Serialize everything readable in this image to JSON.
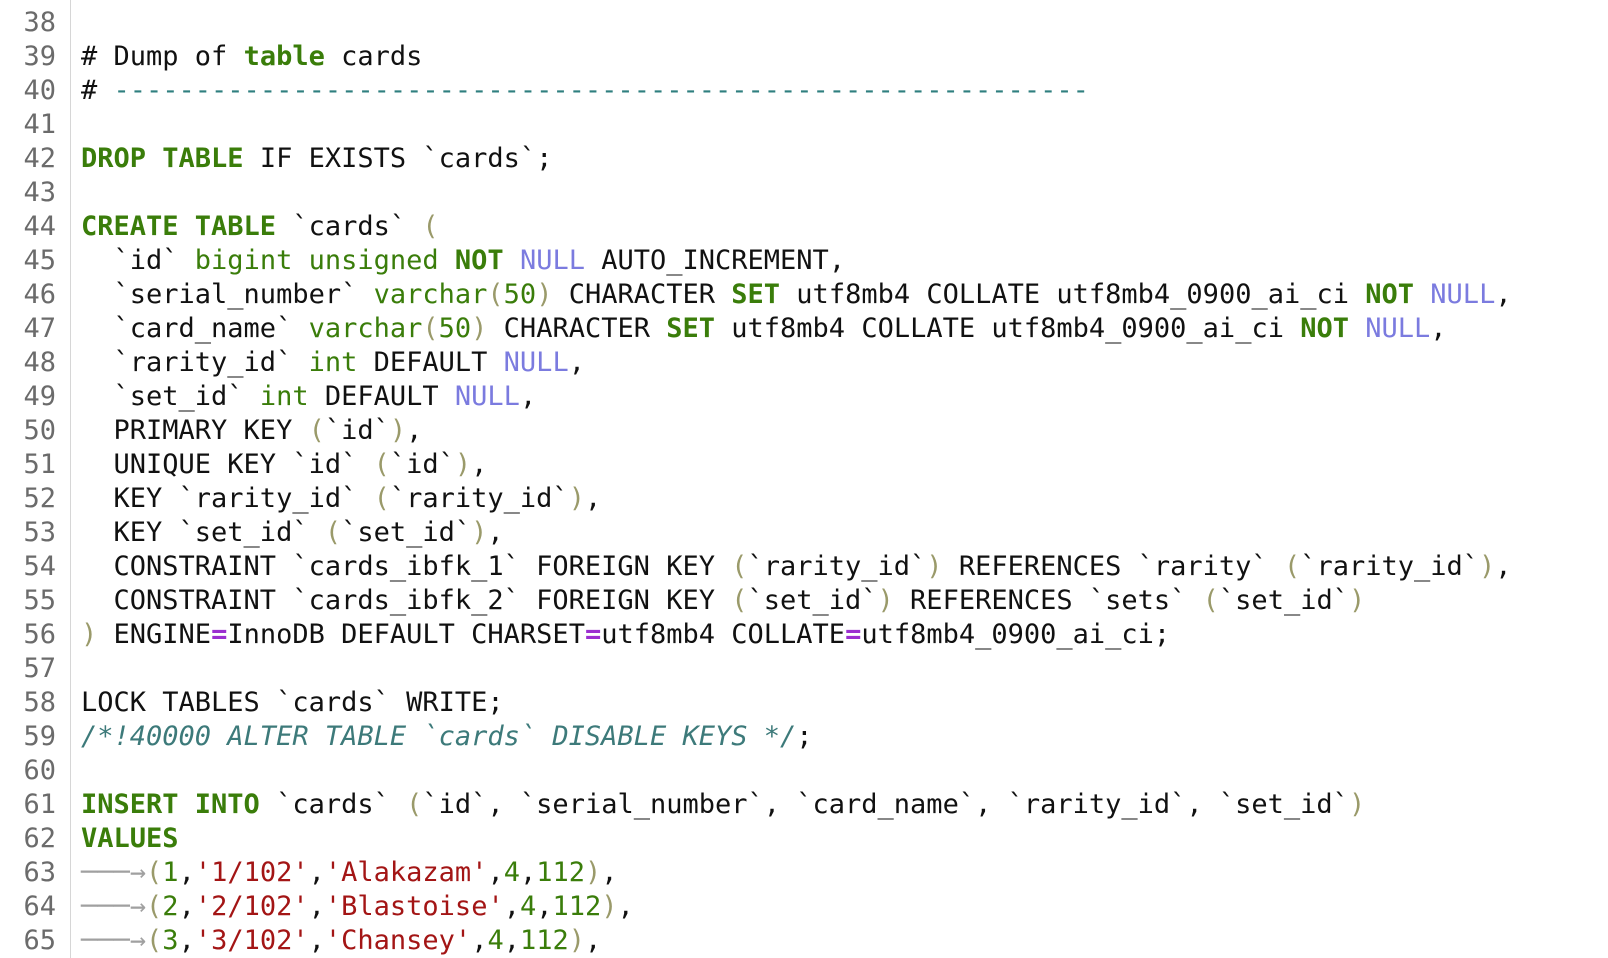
{
  "editor": {
    "language": "SQL",
    "colors": {
      "keyword": "#3a7d0a",
      "null_literal": "#7b7bdf",
      "string": "#a31515",
      "number": "#3a7d0a",
      "comment": "#3d7a7a",
      "operator": "#9b2fd0",
      "line_number": "#6b6b6b"
    },
    "lines": [
      {
        "n": "38",
        "t": [
          {
            "s": "",
            "c": "plain"
          }
        ]
      },
      {
        "n": "39",
        "t": [
          {
            "s": "# Dump of ",
            "c": "plain"
          },
          {
            "s": "table",
            "c": "kw"
          },
          {
            "s": " cards",
            "c": "plain"
          }
        ]
      },
      {
        "n": "40",
        "t": [
          {
            "s": "# ",
            "c": "plain"
          },
          {
            "s": "------------------------------------------------------------",
            "c": "dash"
          }
        ]
      },
      {
        "n": "41",
        "t": [
          {
            "s": "",
            "c": "plain"
          }
        ]
      },
      {
        "n": "42",
        "t": [
          {
            "s": "DROP TABLE",
            "c": "kw"
          },
          {
            "s": " IF EXISTS `cards`;",
            "c": "plain"
          }
        ]
      },
      {
        "n": "43",
        "t": [
          {
            "s": "",
            "c": "plain"
          }
        ]
      },
      {
        "n": "44",
        "t": [
          {
            "s": "CREATE TABLE",
            "c": "kw"
          },
          {
            "s": " `cards` ",
            "c": "plain"
          },
          {
            "s": "(",
            "c": "par"
          }
        ]
      },
      {
        "n": "45",
        "t": [
          {
            "s": "  `id` ",
            "c": "plain"
          },
          {
            "s": "bigint unsigned",
            "c": "ty"
          },
          {
            "s": " ",
            "c": "plain"
          },
          {
            "s": "NOT",
            "c": "kw"
          },
          {
            "s": " ",
            "c": "plain"
          },
          {
            "s": "NULL",
            "c": "nul"
          },
          {
            "s": " AUTO_INCREMENT,",
            "c": "plain"
          }
        ]
      },
      {
        "n": "46",
        "t": [
          {
            "s": "  `serial_number` ",
            "c": "plain"
          },
          {
            "s": "varchar",
            "c": "ty"
          },
          {
            "s": "(",
            "c": "par"
          },
          {
            "s": "50",
            "c": "num"
          },
          {
            "s": ")",
            "c": "par"
          },
          {
            "s": " CHARACTER ",
            "c": "plain"
          },
          {
            "s": "SET",
            "c": "kw"
          },
          {
            "s": " utf8mb4 COLLATE utf8mb4_0900_ai_ci ",
            "c": "plain"
          },
          {
            "s": "NOT",
            "c": "kw"
          },
          {
            "s": " ",
            "c": "plain"
          },
          {
            "s": "NULL",
            "c": "nul"
          },
          {
            "s": ",",
            "c": "plain"
          }
        ]
      },
      {
        "n": "47",
        "t": [
          {
            "s": "  `card_name` ",
            "c": "plain"
          },
          {
            "s": "varchar",
            "c": "ty"
          },
          {
            "s": "(",
            "c": "par"
          },
          {
            "s": "50",
            "c": "num"
          },
          {
            "s": ")",
            "c": "par"
          },
          {
            "s": " CHARACTER ",
            "c": "plain"
          },
          {
            "s": "SET",
            "c": "kw"
          },
          {
            "s": " utf8mb4 COLLATE utf8mb4_0900_ai_ci ",
            "c": "plain"
          },
          {
            "s": "NOT",
            "c": "kw"
          },
          {
            "s": " ",
            "c": "plain"
          },
          {
            "s": "NULL",
            "c": "nul"
          },
          {
            "s": ",",
            "c": "plain"
          }
        ]
      },
      {
        "n": "48",
        "t": [
          {
            "s": "  `rarity_id` ",
            "c": "plain"
          },
          {
            "s": "int",
            "c": "ty"
          },
          {
            "s": " DEFAULT ",
            "c": "plain"
          },
          {
            "s": "NULL",
            "c": "nul"
          },
          {
            "s": ",",
            "c": "plain"
          }
        ]
      },
      {
        "n": "49",
        "t": [
          {
            "s": "  `set_id` ",
            "c": "plain"
          },
          {
            "s": "int",
            "c": "ty"
          },
          {
            "s": " DEFAULT ",
            "c": "plain"
          },
          {
            "s": "NULL",
            "c": "nul"
          },
          {
            "s": ",",
            "c": "plain"
          }
        ]
      },
      {
        "n": "50",
        "t": [
          {
            "s": "  PRIMARY KEY ",
            "c": "plain"
          },
          {
            "s": "(",
            "c": "par"
          },
          {
            "s": "`id`",
            "c": "plain"
          },
          {
            "s": ")",
            "c": "par"
          },
          {
            "s": ",",
            "c": "plain"
          }
        ]
      },
      {
        "n": "51",
        "t": [
          {
            "s": "  UNIQUE KEY `id` ",
            "c": "plain"
          },
          {
            "s": "(",
            "c": "par"
          },
          {
            "s": "`id`",
            "c": "plain"
          },
          {
            "s": ")",
            "c": "par"
          },
          {
            "s": ",",
            "c": "plain"
          }
        ]
      },
      {
        "n": "52",
        "t": [
          {
            "s": "  KEY `rarity_id` ",
            "c": "plain"
          },
          {
            "s": "(",
            "c": "par"
          },
          {
            "s": "`rarity_id`",
            "c": "plain"
          },
          {
            "s": ")",
            "c": "par"
          },
          {
            "s": ",",
            "c": "plain"
          }
        ]
      },
      {
        "n": "53",
        "t": [
          {
            "s": "  KEY `set_id` ",
            "c": "plain"
          },
          {
            "s": "(",
            "c": "par"
          },
          {
            "s": "`set_id`",
            "c": "plain"
          },
          {
            "s": ")",
            "c": "par"
          },
          {
            "s": ",",
            "c": "plain"
          }
        ]
      },
      {
        "n": "54",
        "t": [
          {
            "s": "  CONSTRAINT `cards_ibfk_1` FOREIGN KEY ",
            "c": "plain"
          },
          {
            "s": "(",
            "c": "par"
          },
          {
            "s": "`rarity_id`",
            "c": "plain"
          },
          {
            "s": ")",
            "c": "par"
          },
          {
            "s": " REFERENCES `rarity` ",
            "c": "plain"
          },
          {
            "s": "(",
            "c": "par"
          },
          {
            "s": "`rarity_id`",
            "c": "plain"
          },
          {
            "s": ")",
            "c": "par"
          },
          {
            "s": ",",
            "c": "plain"
          }
        ]
      },
      {
        "n": "55",
        "t": [
          {
            "s": "  CONSTRAINT `cards_ibfk_2` FOREIGN KEY ",
            "c": "plain"
          },
          {
            "s": "(",
            "c": "par"
          },
          {
            "s": "`set_id`",
            "c": "plain"
          },
          {
            "s": ")",
            "c": "par"
          },
          {
            "s": " REFERENCES `sets` ",
            "c": "plain"
          },
          {
            "s": "(",
            "c": "par"
          },
          {
            "s": "`set_id`",
            "c": "plain"
          },
          {
            "s": ")",
            "c": "par"
          }
        ]
      },
      {
        "n": "56",
        "t": [
          {
            "s": ")",
            "c": "par"
          },
          {
            "s": " ENGINE",
            "c": "plain"
          },
          {
            "s": "=",
            "c": "eqop"
          },
          {
            "s": "InnoDB DEFAULT CHARSET",
            "c": "plain"
          },
          {
            "s": "=",
            "c": "eqop"
          },
          {
            "s": "utf8mb4 COLLATE",
            "c": "plain"
          },
          {
            "s": "=",
            "c": "eqop"
          },
          {
            "s": "utf8mb4_0900_ai_ci;",
            "c": "plain"
          }
        ]
      },
      {
        "n": "57",
        "t": [
          {
            "s": "",
            "c": "plain"
          }
        ]
      },
      {
        "n": "58",
        "t": [
          {
            "s": "LOCK TABLES `cards` WRITE;",
            "c": "plain"
          }
        ]
      },
      {
        "n": "59",
        "t": [
          {
            "s": "/*!40000 ALTER TABLE `cards` DISABLE KEYS */",
            "c": "cmt"
          },
          {
            "s": ";",
            "c": "plain"
          }
        ]
      },
      {
        "n": "60",
        "t": [
          {
            "s": "",
            "c": "plain"
          }
        ]
      },
      {
        "n": "61",
        "t": [
          {
            "s": "INSERT INTO",
            "c": "kw"
          },
          {
            "s": " `cards` ",
            "c": "plain"
          },
          {
            "s": "(",
            "c": "par"
          },
          {
            "s": "`id`, `serial_number`, `card_name`, `rarity_id`, `set_id`",
            "c": "plain"
          },
          {
            "s": ")",
            "c": "par"
          }
        ]
      },
      {
        "n": "62",
        "t": [
          {
            "s": "VALUES",
            "c": "kw"
          }
        ]
      },
      {
        "n": "63",
        "t": [
          {
            "s": "───→",
            "c": "tab"
          },
          {
            "s": "(",
            "c": "par"
          },
          {
            "s": "1",
            "c": "num"
          },
          {
            "s": ",",
            "c": "plain"
          },
          {
            "s": "'1/102'",
            "c": "str"
          },
          {
            "s": ",",
            "c": "plain"
          },
          {
            "s": "'Alakazam'",
            "c": "str"
          },
          {
            "s": ",",
            "c": "plain"
          },
          {
            "s": "4",
            "c": "num"
          },
          {
            "s": ",",
            "c": "plain"
          },
          {
            "s": "112",
            "c": "num"
          },
          {
            "s": ")",
            "c": "par"
          },
          {
            "s": ",",
            "c": "plain"
          }
        ]
      },
      {
        "n": "64",
        "t": [
          {
            "s": "───→",
            "c": "tab"
          },
          {
            "s": "(",
            "c": "par"
          },
          {
            "s": "2",
            "c": "num"
          },
          {
            "s": ",",
            "c": "plain"
          },
          {
            "s": "'2/102'",
            "c": "str"
          },
          {
            "s": ",",
            "c": "plain"
          },
          {
            "s": "'Blastoise'",
            "c": "str"
          },
          {
            "s": ",",
            "c": "plain"
          },
          {
            "s": "4",
            "c": "num"
          },
          {
            "s": ",",
            "c": "plain"
          },
          {
            "s": "112",
            "c": "num"
          },
          {
            "s": ")",
            "c": "par"
          },
          {
            "s": ",",
            "c": "plain"
          }
        ]
      },
      {
        "n": "65",
        "t": [
          {
            "s": "───→",
            "c": "tab"
          },
          {
            "s": "(",
            "c": "par"
          },
          {
            "s": "3",
            "c": "num"
          },
          {
            "s": ",",
            "c": "plain"
          },
          {
            "s": "'3/102'",
            "c": "str"
          },
          {
            "s": ",",
            "c": "plain"
          },
          {
            "s": "'Chansey'",
            "c": "str"
          },
          {
            "s": ",",
            "c": "plain"
          },
          {
            "s": "4",
            "c": "num"
          },
          {
            "s": ",",
            "c": "plain"
          },
          {
            "s": "112",
            "c": "num"
          },
          {
            "s": ")",
            "c": "par"
          },
          {
            "s": ",",
            "c": "plain"
          }
        ]
      }
    ]
  }
}
